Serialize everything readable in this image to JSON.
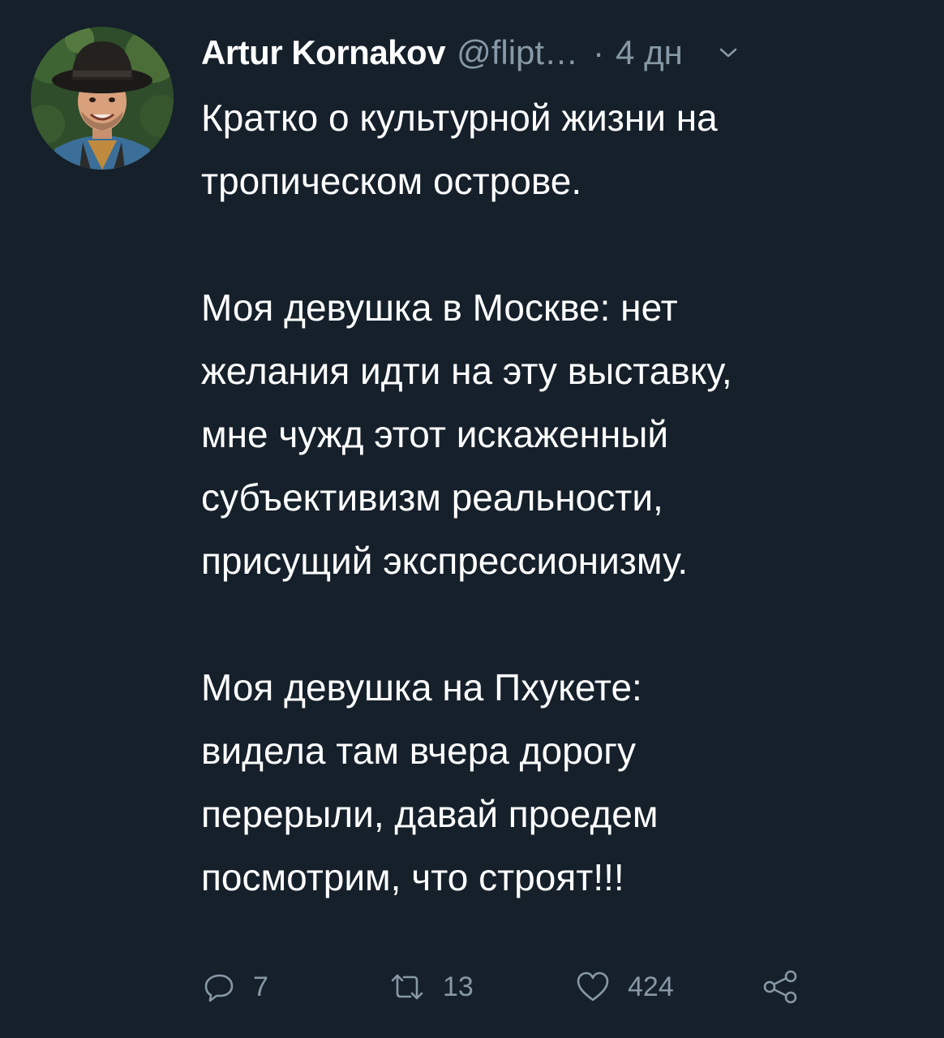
{
  "author": {
    "display_name": "Artur Kornakov",
    "handle": "@flipt…",
    "separator": "·",
    "time": "4 дн"
  },
  "tweet": {
    "paragraphs": [
      {
        "lines": [
          "Кратко о культурной жизни на",
          "тропическом острове."
        ]
      },
      {
        "lines": [
          "Моя девушка в Москве: нет",
          "желания идти на эту выставку,",
          "мне чужд этот искаженный",
          "субъективизм реальности,",
          "присущий экспрессионизму."
        ]
      },
      {
        "lines": [
          "Моя девушка на Пхукете:",
          "видела там вчера дорогу",
          "перерыли, давай проедем",
          "посмотрим, что строят!!!"
        ]
      }
    ]
  },
  "actions": {
    "reply_count": "7",
    "retweet_count": "13",
    "like_count": "424"
  },
  "icons": {
    "reply": "reply-icon",
    "retweet": "retweet-icon",
    "like": "heart-icon",
    "share": "share-icon",
    "more": "chevron-down-icon"
  },
  "colors": {
    "background": "#15202b",
    "text": "#ffffff",
    "secondary": "#8899a6"
  }
}
